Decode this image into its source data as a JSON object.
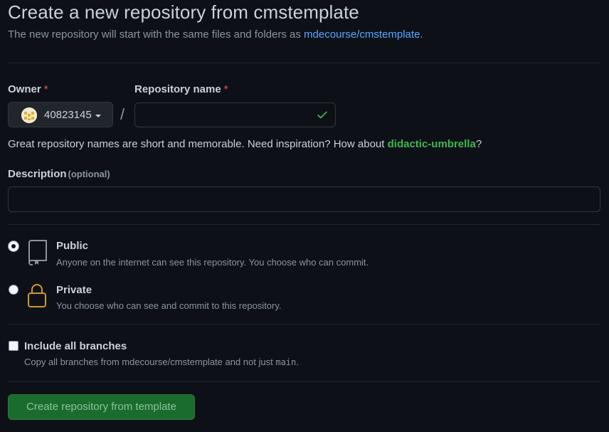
{
  "header": {
    "title": "Create a new repository from cmstemplate",
    "subtitle_prefix": "The new repository will start with the same files and folders as ",
    "template_link": "mdecourse/cmstemplate",
    "subtitle_suffix": "."
  },
  "owner": {
    "label": "Owner",
    "required_mark": "*",
    "selected": "40823145",
    "avatar_icon": "identicon-avatar"
  },
  "separator": "/",
  "repo_name": {
    "label": "Repository name",
    "required_mark": "*",
    "value": "",
    "valid_icon": "check-icon"
  },
  "hint": {
    "prefix": "Great repository names are short and memorable. Need inspiration? How about ",
    "suggestion": "didactic-umbrella",
    "suffix": "?"
  },
  "description": {
    "label": "Description",
    "optional": "(optional)",
    "value": ""
  },
  "visibility": {
    "selected": "public",
    "public": {
      "title": "Public",
      "desc": "Anyone on the internet can see this repository. You choose who can commit.",
      "icon": "repo-icon"
    },
    "private": {
      "title": "Private",
      "desc": "You choose who can see and commit to this repository.",
      "icon": "lock-icon"
    }
  },
  "include_branches": {
    "label": "Include all branches",
    "checked": false,
    "desc_prefix": "Copy all branches from mdecourse/cmstemplate and not just ",
    "desc_code": "main",
    "desc_suffix": "."
  },
  "submit": {
    "label": "Create repository from template"
  },
  "colors": {
    "background": "#0d1117",
    "link": "#58a6ff",
    "success": "#3fb950",
    "danger": "#f85149",
    "lock": "#d29922",
    "button": "#196c2e"
  }
}
